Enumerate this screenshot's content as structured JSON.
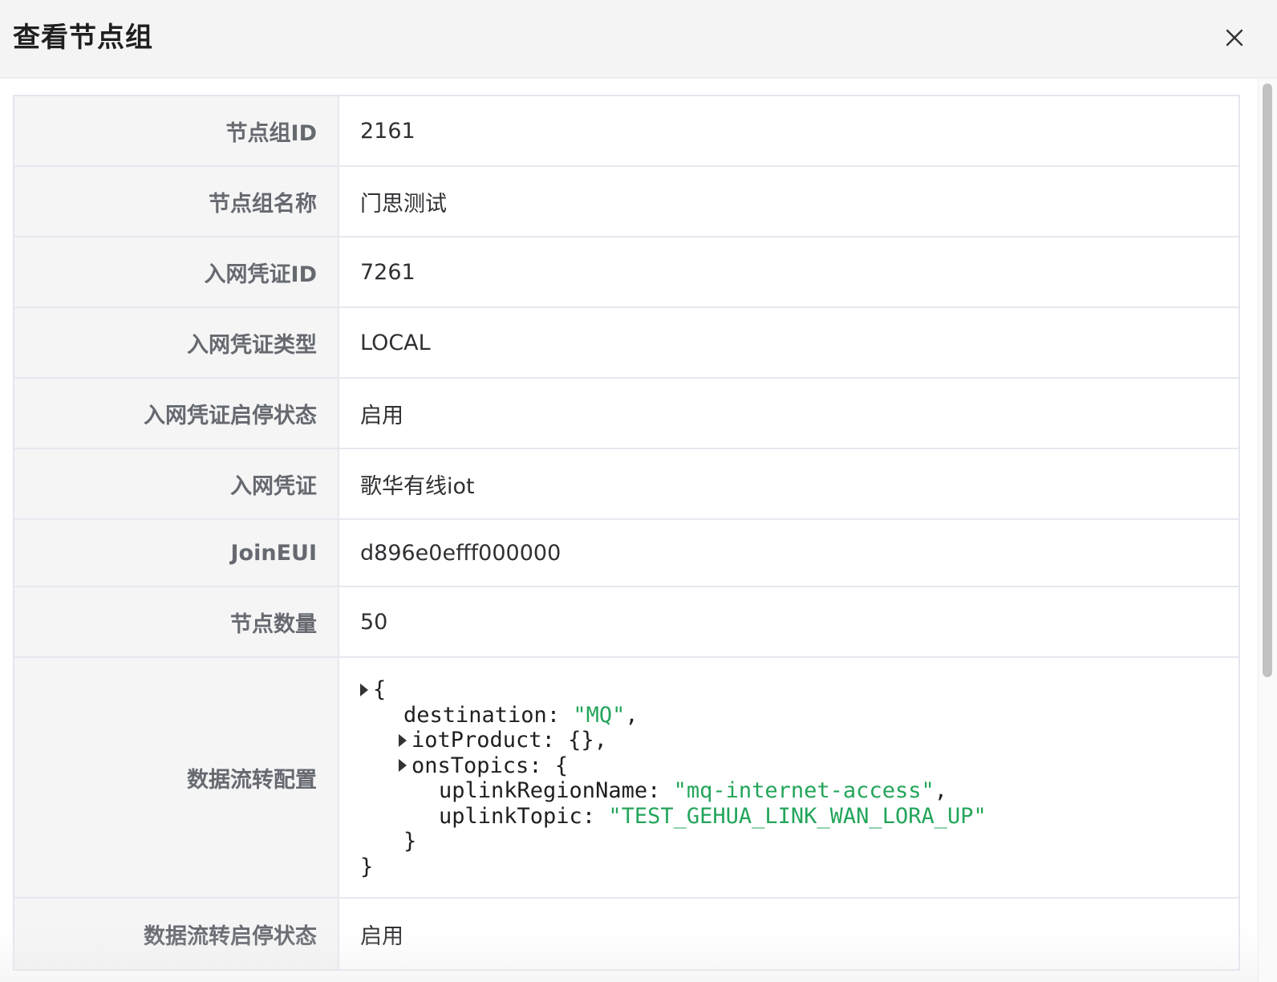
{
  "header": {
    "title": "查看节点组",
    "close_icon": "close-icon"
  },
  "rows": [
    {
      "label": "节点组ID",
      "value": "2161"
    },
    {
      "label": "节点组名称",
      "value": "门思测试"
    },
    {
      "label": "入网凭证ID",
      "value": "7261"
    },
    {
      "label": "入网凭证类型",
      "value": "LOCAL"
    },
    {
      "label": "入网凭证启停状态",
      "value": "启用"
    },
    {
      "label": "入网凭证",
      "value": "歌华有线iot"
    },
    {
      "label": "JoinEUI",
      "value": "d896e0efff000000"
    },
    {
      "label": "节点数量",
      "value": "50"
    },
    {
      "label": "数据流转配置",
      "value": ""
    },
    {
      "label": "数据流转启停状态",
      "value": "启用"
    }
  ],
  "json_config": {
    "open_brace": "{",
    "destination_key": "destination",
    "destination_value": "\"MQ\"",
    "iotProduct_key": "iotProduct",
    "iotProduct_value": "{}",
    "onsTopics_key": "onsTopics",
    "onsTopics_open": "{",
    "uplinkRegionName_key": "uplinkRegionName",
    "uplinkRegionName_value": "\"mq-internet-access\"",
    "uplinkTopic_key": "uplinkTopic",
    "uplinkTopic_value": "\"TEST_GEHUA_LINK_WAN_LORA_UP\"",
    "onsTopics_close": "}",
    "close_brace": "}"
  },
  "colors": {
    "string_value": "#23a55a",
    "label_bg": "#f5f5f6",
    "border": "#e6e8ef"
  }
}
